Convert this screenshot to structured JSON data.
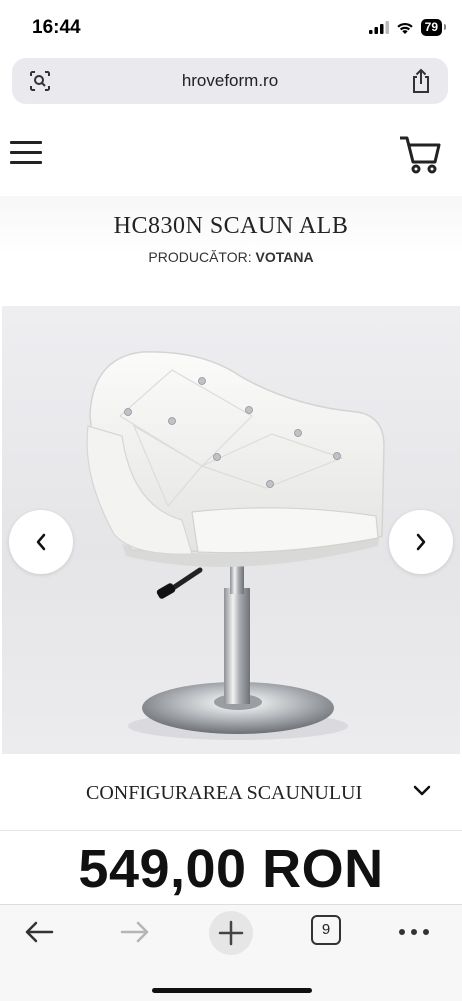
{
  "status": {
    "time": "16:44",
    "battery": "79"
  },
  "browser": {
    "url": "hroveform.ro",
    "tab_count": "9"
  },
  "product": {
    "title": "HC830N SCAUN ALB",
    "manufacturer_label": "PRODUCĂTOR:",
    "manufacturer": "VOTANA",
    "config_label": "CONFIGURAREA SCAUNULUI",
    "price": "549,00 RON"
  },
  "colors": {
    "accent": "#111111",
    "chair": "#f4f4f2",
    "chrome": "#b9bcc0"
  }
}
